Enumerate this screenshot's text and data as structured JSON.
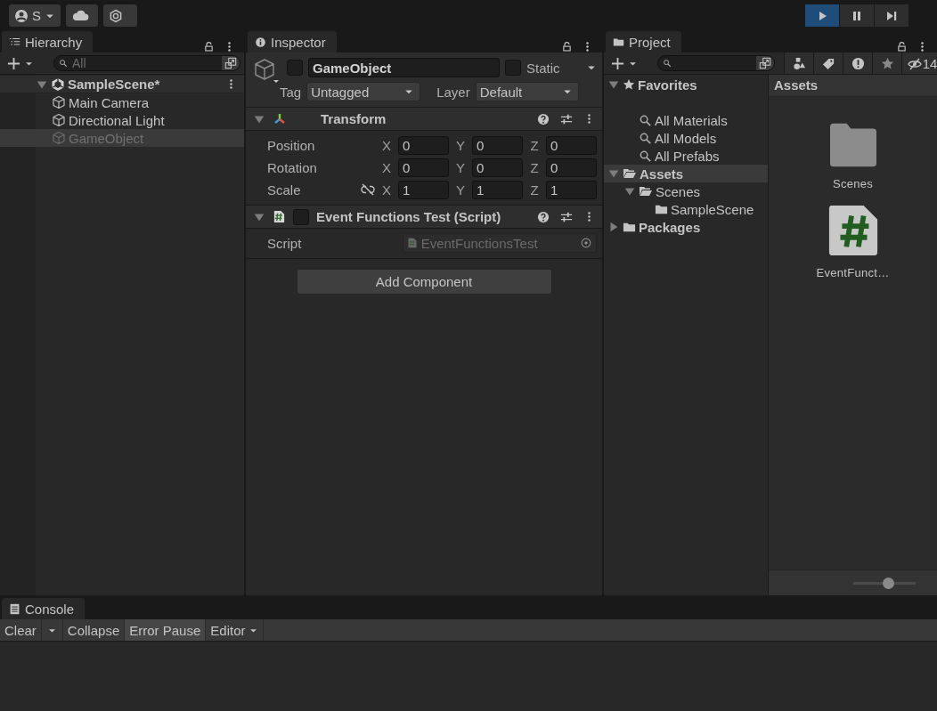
{
  "toolbar": {
    "account": {
      "label": "S"
    },
    "play_controls": [
      {
        "kind": "play",
        "selected": true
      },
      {
        "kind": "pause",
        "selected": false
      },
      {
        "kind": "step",
        "selected": false
      }
    ]
  },
  "hierarchy": {
    "tab": {
      "label": "Hierarchy",
      "selected": true
    },
    "search": {
      "placeholder": "All"
    },
    "tree": [
      {
        "kind": "scene",
        "label": "SampleScene*",
        "expanded": true,
        "selected": false,
        "active": true,
        "children": [
          {
            "kind": "object",
            "label": "Main Camera",
            "selected": false,
            "active": true
          },
          {
            "kind": "object",
            "label": "Directional Light",
            "selected": false,
            "active": true
          },
          {
            "kind": "object",
            "label": "GameObject",
            "selected": true,
            "active": false
          }
        ]
      }
    ]
  },
  "inspector": {
    "tab": {
      "label": "Inspector",
      "selected": true
    },
    "object": {
      "name": "GameObject",
      "active": false,
      "static_label": "Static",
      "static": false,
      "tag_label": "Tag",
      "tag": "Untagged",
      "layer_label": "Layer",
      "layer": "Default"
    },
    "components": [
      {
        "kind": "transform",
        "title": "Transform",
        "expanded": true,
        "rows": [
          {
            "label": "Position",
            "values": [
              {
                "axis": "X",
                "value": "0"
              },
              {
                "axis": "Y",
                "value": "0"
              },
              {
                "axis": "Z",
                "value": "0"
              }
            ]
          },
          {
            "label": "Rotation",
            "values": [
              {
                "axis": "X",
                "value": "0"
              },
              {
                "axis": "Y",
                "value": "0"
              },
              {
                "axis": "Z",
                "value": "0"
              }
            ]
          },
          {
            "label": "Scale",
            "constrained": false,
            "values": [
              {
                "axis": "X",
                "value": "1"
              },
              {
                "axis": "Y",
                "value": "1"
              },
              {
                "axis": "Z",
                "value": "1"
              }
            ]
          }
        ]
      },
      {
        "kind": "script",
        "title": "Event Functions Test (Script)",
        "expanded": true,
        "enabled": false,
        "field_label": "Script",
        "field_value": "EventFunctionsTest"
      }
    ],
    "add_button": "Add Component"
  },
  "project": {
    "tab": {
      "label": "Project",
      "selected": true
    },
    "hidden_count": "14",
    "tree": [
      {
        "kind": "favorites",
        "label": "Favorites",
        "expanded": true,
        "selected": false,
        "children": [
          {
            "kind": "search",
            "label": "All Materials",
            "selected": false
          },
          {
            "kind": "search",
            "label": "All Models",
            "selected": false
          },
          {
            "kind": "search",
            "label": "All Prefabs",
            "selected": false
          }
        ]
      },
      {
        "kind": "folder",
        "label": "Assets",
        "expanded": true,
        "selected": true,
        "children": [
          {
            "kind": "folder",
            "label": "Scenes",
            "expanded": true,
            "selected": false,
            "children": [
              {
                "kind": "folder",
                "label": "SampleScene",
                "selected": false
              }
            ]
          }
        ]
      },
      {
        "kind": "folder",
        "label": "Packages",
        "expanded": false,
        "selected": false
      }
    ],
    "breadcrumb": "Assets",
    "items": [
      {
        "kind": "folder",
        "label": "Scenes"
      },
      {
        "kind": "script",
        "label": "EventFunct…"
      }
    ],
    "zoom": {
      "level": 0.56
    }
  },
  "console": {
    "tab": {
      "label": "Console",
      "selected": true
    },
    "buttons": [
      {
        "kind": "split",
        "label": "Clear"
      },
      {
        "kind": "toggle",
        "label": "Collapse",
        "on": false
      },
      {
        "kind": "toggle",
        "label": "Error Pause",
        "on": true
      },
      {
        "kind": "dropdown",
        "label": "Editor"
      }
    ]
  }
}
